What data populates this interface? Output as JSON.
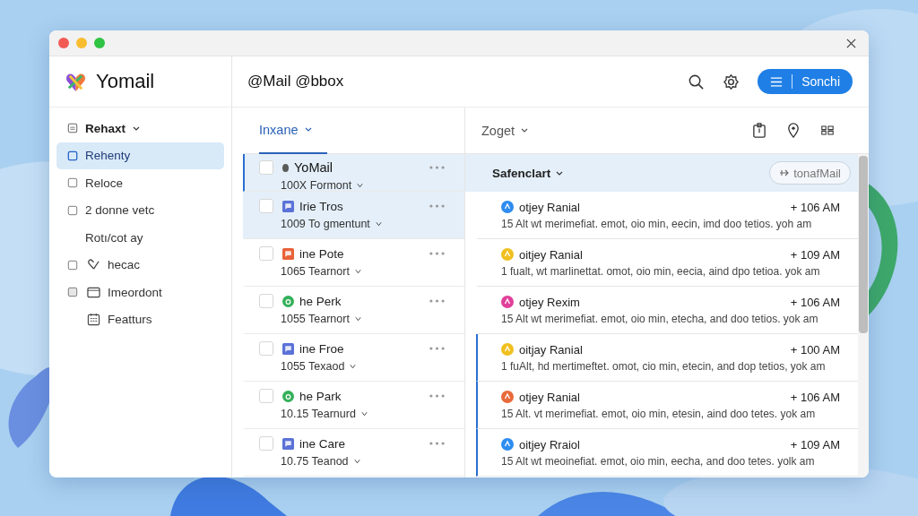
{
  "sidebar": {
    "logo": "Yomail",
    "items": [
      {
        "label": "Rehaxt",
        "kind": "folder",
        "expandable": true,
        "selected": false
      },
      {
        "label": "Rehenty",
        "kind": "square",
        "expandable": false,
        "selected": true
      },
      {
        "label": "Reloce",
        "kind": "checkbox",
        "expandable": false,
        "selected": false
      },
      {
        "label": "2 donne vetc",
        "kind": "checkbox",
        "expandable": false,
        "selected": false
      },
      {
        "label": "Rotı/cot ay",
        "kind": "plain",
        "expandable": false,
        "selected": false
      },
      {
        "label": "hecac",
        "kind": "checkbox-heart",
        "expandable": false,
        "selected": false
      },
      {
        "label": "Imeordont",
        "kind": "checkbox-window",
        "expandable": false,
        "selected": false
      },
      {
        "label": "Featturs",
        "kind": "calendar",
        "expandable": false,
        "selected": false
      }
    ]
  },
  "header": {
    "title": "@Mail @bbox",
    "button": "Sonchi"
  },
  "list": {
    "tab": {
      "label": "Inxane",
      "selected": true
    },
    "rows": [
      {
        "name": "YoMail",
        "subtitle": "100X Formont",
        "kind": "dot",
        "color": "#5a5a5a",
        "selected": true
      },
      {
        "name": "Irie Tros",
        "subtitle": "1009 To gmentunt",
        "kind": "square",
        "color": "#5b72d8",
        "selected": true
      },
      {
        "name": "ine Pote",
        "subtitle": "1065 Tearnort",
        "kind": "square",
        "color": "#e8623a",
        "selected": false
      },
      {
        "name": "he Perk",
        "subtitle": "1055 Tearnort",
        "kind": "circle",
        "color": "#34b05a",
        "selected": false
      },
      {
        "name": "ine Froe",
        "subtitle": "1055 Texaod",
        "kind": "square",
        "color": "#5b72d8",
        "selected": false
      },
      {
        "name": "he Park",
        "subtitle": "10.15 Tearnurd",
        "kind": "circle",
        "color": "#34b05a",
        "selected": false
      },
      {
        "name": "ine Care",
        "subtitle": "10.75 Teanod",
        "kind": "square",
        "color": "#5b72d8",
        "selected": false
      }
    ]
  },
  "preview": {
    "tab": "Zoget",
    "heading": "Safenclart",
    "pill": "tonafMail",
    "items": [
      {
        "sender": "otjey Ranial",
        "time": "+ 106 AM",
        "snippet": "15 Alt wt merimefiat. emot, oio min, eecin, imd doo tetios. yoh am",
        "color": "#2d8cf0",
        "flagged": false
      },
      {
        "sender": "oitjey Ranial",
        "time": "+ 109 AM",
        "snippet": "1 fualt, wt marlinettat. omot, oio min, eecia, aind dpo tetioa. yok am",
        "color": "#f0c020",
        "flagged": false
      },
      {
        "sender": "otjey Rexim",
        "time": "+ 106 AM",
        "snippet": "15 Alt wt merimefiat. emot, oio min, etecha, and doo tetios. yok am",
        "color": "#e0409a",
        "flagged": false
      },
      {
        "sender": "oitjay Ranial",
        "time": "+ 100 AM",
        "snippet": "1 fuAlt, hd mertimeftet. omot, cio min, etecin, and dop tetios, yok am",
        "color": "#f0c020",
        "flagged": true
      },
      {
        "sender": "otjey Ranial",
        "time": "+ 106 AM",
        "snippet": "15 Alt. vt merimefiat. emot, oio min, etesin, aind doo tetes. yok am",
        "color": "#e86a3a",
        "flagged": true
      },
      {
        "sender": "oitjey Rraiol",
        "time": "+ 109 AM",
        "snippet": "15 Alt wt meoinefiat. emot, oio min, eecha, and doo tetes. yolk am",
        "color": "#2d8cf0",
        "flagged": true
      }
    ]
  }
}
